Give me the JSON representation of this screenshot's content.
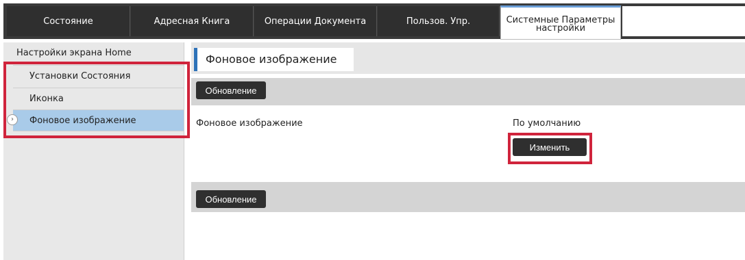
{
  "tabs": [
    "Состояние",
    "Адресная Книга",
    "Операции Документа",
    "Пользов. Упр."
  ],
  "active_tab": {
    "line1": "Системные Параметры",
    "line2": "настройки"
  },
  "sidebar": {
    "header": "Настройки экрана Home",
    "items": [
      "Установки Состояния",
      "Иконка",
      "Фоновое изображение"
    ],
    "selected_index": 2
  },
  "main": {
    "title": "Фоновое изображение",
    "update_button": "Обновление",
    "setting_label": "Фоновое изображение",
    "setting_value": "По умолчанию",
    "change_button": "Изменить"
  },
  "colors": {
    "highlight": "#d0243c",
    "selected_item": "#a9cbe9",
    "title_accent": "#2e72b8",
    "tab_active_accent": "#6a9ed8"
  },
  "icons": {
    "selected_item_marker": "chevron-right-circle-icon"
  }
}
